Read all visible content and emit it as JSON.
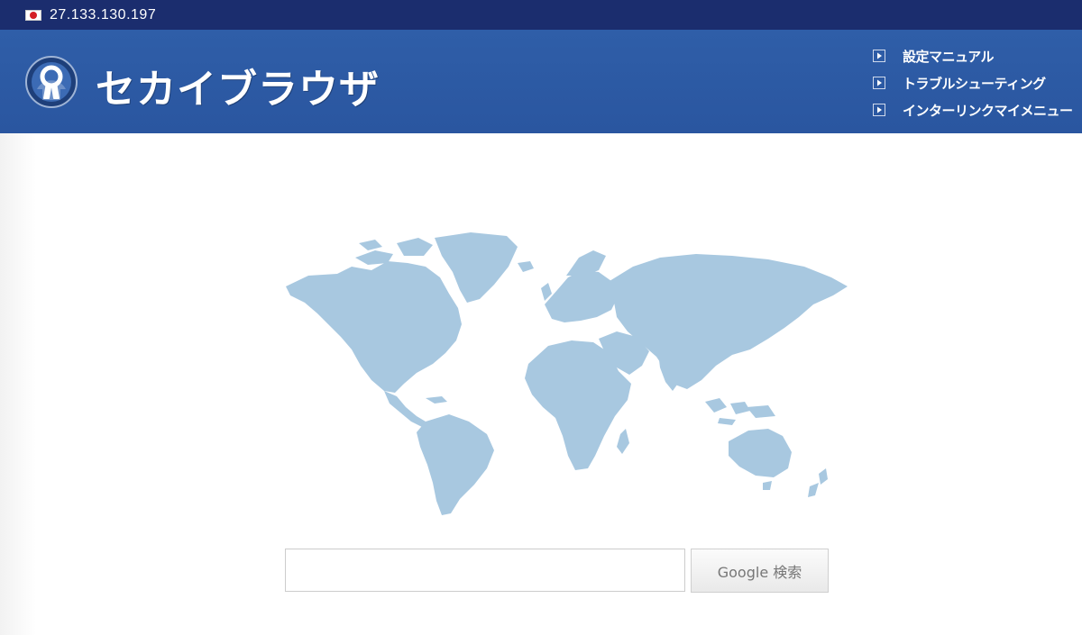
{
  "topbar": {
    "ip_address": "27.133.130.197",
    "flag_icon": "japan-flag-icon"
  },
  "header": {
    "logo_icon": "keyhole-logo-icon",
    "logo_text": "セカイブラウザ",
    "nav": [
      {
        "label": "設定マニュアル",
        "icon": "play-arrow-icon"
      },
      {
        "label": "トラブルシューティング",
        "icon": "play-arrow-icon"
      },
      {
        "label": "インターリンクマイメニュー",
        "icon": "play-arrow-icon"
      }
    ]
  },
  "main": {
    "map_icon": "world-map-icon",
    "search": {
      "value": "",
      "placeholder": "",
      "button_label": "Google 検索"
    }
  },
  "colors": {
    "topbar_bg": "#1b2d6e",
    "header_bg": "#2f5ea8",
    "map_fill": "#a8c8e0"
  }
}
